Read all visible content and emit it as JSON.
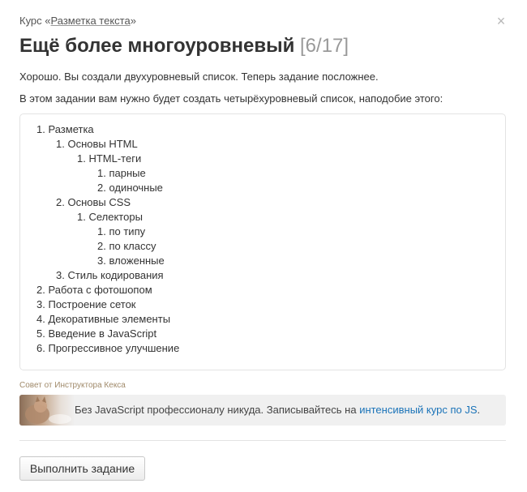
{
  "header": {
    "course_prefix": "Курс «",
    "course_name": "Разметка текста",
    "course_suffix": "»",
    "close_glyph": "×",
    "title": "Ещё более многоуровневый",
    "progress": "[6/17]"
  },
  "intro": {
    "paragraph1": "Хорошо. Вы создали двухуровневый список. Теперь задание посложнее.",
    "paragraph2": "В этом задании вам нужно будет создать четырёхуровневый список, наподобие этого:"
  },
  "example_list": [
    {
      "num": "1.",
      "text": "Разметка"
    },
    {
      "num": "1.",
      "text": "Основы HTML"
    },
    {
      "num": "1.",
      "text": "HTML-теги"
    },
    {
      "num": "1.",
      "text": "парные"
    },
    {
      "num": "2.",
      "text": "одиночные"
    },
    {
      "num": "2.",
      "text": "Основы CSS"
    },
    {
      "num": "1.",
      "text": "Селекторы"
    },
    {
      "num": "1.",
      "text": "по типу"
    },
    {
      "num": "2.",
      "text": "по классу"
    },
    {
      "num": "3.",
      "text": "вложенные"
    },
    {
      "num": "3.",
      "text": "Стиль кодирования"
    },
    {
      "num": "2.",
      "text": "Работа с фотошопом"
    },
    {
      "num": "3.",
      "text": "Построение сеток"
    },
    {
      "num": "4.",
      "text": "Декоративные элементы"
    },
    {
      "num": "5.",
      "text": "Введение в JavaScript"
    },
    {
      "num": "6.",
      "text": "Прогрессивное улучшение"
    }
  ],
  "tip": {
    "caption": "Совет от Инструктора Кекса",
    "text_before": "Без JavaScript профессионалу никуда. Записывайтесь на ",
    "link_text": "интенсивный курс по JS",
    "text_after": "."
  },
  "actions": {
    "submit_label": "Выполнить задание"
  },
  "colors": {
    "link": "#1a73b8",
    "progress": "#999999",
    "tip_caption": "#a08a6a"
  }
}
